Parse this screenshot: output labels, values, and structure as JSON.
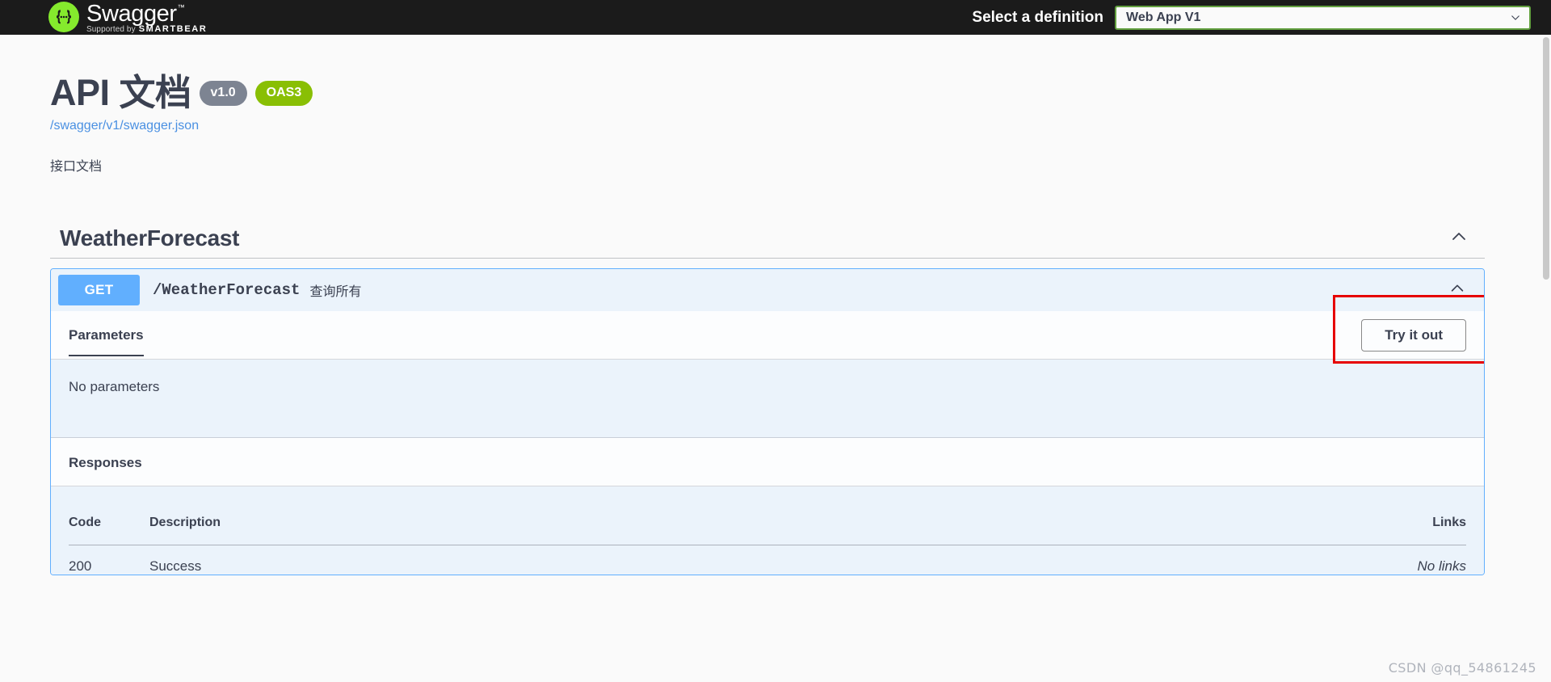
{
  "topbar": {
    "logo_name": "Swagger",
    "logo_tm": "™",
    "logo_supported_by": "Supported by",
    "logo_brand": "SMARTBEAR",
    "select_definition_label": "Select a definition",
    "definition_value": "Web App V1",
    "caret_icon": "chevron-down-icon"
  },
  "info": {
    "title": "API 文档",
    "version_badge": "v1.0",
    "oas_badge": "OAS3",
    "spec_url": "/swagger/v1/swagger.json",
    "description": "接口文档"
  },
  "tag": {
    "name": "WeatherForecast",
    "collapse_icon": "chevron-up-icon"
  },
  "operation": {
    "method": "GET",
    "path": "/WeatherForecast",
    "summary": "查询所有",
    "collapse_icon": "chevron-up-icon",
    "parameters_heading": "Parameters",
    "try_it_out_label": "Try it out",
    "no_parameters_text": "No parameters",
    "responses_heading": "Responses",
    "table": {
      "headers": {
        "code": "Code",
        "description": "Description",
        "links": "Links"
      },
      "rows": [
        {
          "code": "200",
          "description": "Success",
          "links": "No links"
        }
      ]
    }
  },
  "watermark": "CSDN @qq_54861245",
  "colors": {
    "topbar_bg": "#1b1b1b",
    "swagger_green": "#85ea2d",
    "select_border": "#62a03f",
    "get_blue": "#61affe",
    "opblock_bg": "#ebf3fb",
    "version_badge": "#7d8492",
    "oas_badge": "#89bf04",
    "link_blue": "#4a90e2",
    "text_dark": "#3b4151",
    "annotation_red": "#e60000"
  }
}
